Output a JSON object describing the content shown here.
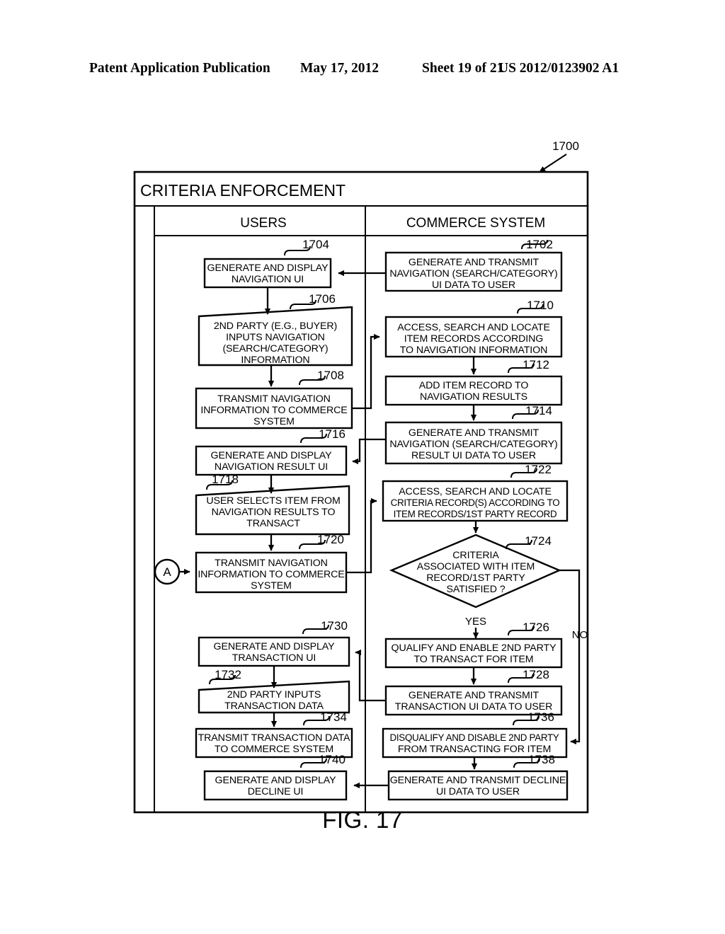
{
  "header": {
    "publication": "Patent Application Publication",
    "date": "May 17, 2012",
    "sheet": "Sheet 19 of 21",
    "docnumber": "US 2012/0123902 A1"
  },
  "figure": {
    "caption": "FIG. 17",
    "diagram_ref": "1700",
    "title": "CRITERIA ENFORCEMENT",
    "columns": [
      {
        "label": "USERS"
      },
      {
        "label": "COMMERCE SYSTEM"
      }
    ],
    "connectors": [
      {
        "label": "A"
      }
    ],
    "branch_labels": {
      "yes": "YES",
      "no": "NO"
    },
    "nodes": [
      {
        "ref": "1702",
        "column": "commerce",
        "shape": "process",
        "lines": [
          "GENERATE AND TRANSMIT",
          "NAVIGATION (SEARCH/CATEGORY)",
          "UI DATA TO USER"
        ]
      },
      {
        "ref": "1704",
        "column": "users",
        "shape": "process",
        "lines": [
          "GENERATE AND DISPLAY",
          "NAVIGATION UI"
        ]
      },
      {
        "ref": "1706",
        "column": "users",
        "shape": "manual-input",
        "lines": [
          "2ND PARTY (E.G., BUYER)",
          "INPUTS NAVIGATION",
          "(SEARCH/CATEGORY)",
          "INFORMATION"
        ]
      },
      {
        "ref": "1708",
        "column": "users",
        "shape": "process",
        "lines": [
          "TRANSMIT NAVIGATION",
          "INFORMATION TO COMMERCE",
          "SYSTEM"
        ]
      },
      {
        "ref": "1710",
        "column": "commerce",
        "shape": "process",
        "lines": [
          "ACCESS, SEARCH AND LOCATE",
          "ITEM RECORDS ACCORDING",
          "TO NAVIGATION INFORMATION"
        ]
      },
      {
        "ref": "1712",
        "column": "commerce",
        "shape": "process",
        "lines": [
          "ADD ITEM RECORD TO",
          "NAVIGATION RESULTS"
        ]
      },
      {
        "ref": "1714",
        "column": "commerce",
        "shape": "process",
        "lines": [
          "GENERATE AND TRANSMIT",
          "NAVIGATION (SEARCH/CATEGORY)",
          "RESULT UI DATA TO USER"
        ]
      },
      {
        "ref": "1716",
        "column": "users",
        "shape": "process",
        "lines": [
          "GENERATE AND DISPLAY",
          "NAVIGATION RESULT UI"
        ]
      },
      {
        "ref": "1718",
        "column": "users",
        "shape": "manual-input",
        "lines": [
          "USER SELECTS ITEM FROM",
          "NAVIGATION RESULTS TO",
          "TRANSACT"
        ]
      },
      {
        "ref": "1720",
        "column": "users",
        "shape": "process",
        "lines": [
          "TRANSMIT NAVIGATION",
          "INFORMATION TO COMMERCE",
          "SYSTEM"
        ]
      },
      {
        "ref": "1722",
        "column": "commerce",
        "shape": "process",
        "lines": [
          "ACCESS, SEARCH AND LOCATE",
          "CRITERIA RECORD(S) ACCORDING TO",
          "ITEM RECORDS/1ST PARTY RECORD"
        ]
      },
      {
        "ref": "1724",
        "column": "commerce",
        "shape": "decision",
        "lines": [
          "CRITERIA",
          "ASSOCIATED WITH ITEM",
          "RECORD/1ST PARTY",
          "SATISFIED ?"
        ]
      },
      {
        "ref": "1726",
        "column": "commerce",
        "shape": "process",
        "lines": [
          "QUALIFY AND ENABLE 2ND PARTY",
          "TO TRANSACT FOR ITEM"
        ]
      },
      {
        "ref": "1728",
        "column": "commerce",
        "shape": "process",
        "lines": [
          "GENERATE AND TRANSMIT",
          "TRANSACTION UI DATA TO USER"
        ]
      },
      {
        "ref": "1730",
        "column": "users",
        "shape": "process",
        "lines": [
          "GENERATE AND DISPLAY",
          "TRANSACTION UI"
        ]
      },
      {
        "ref": "1732",
        "column": "users",
        "shape": "manual-input",
        "lines": [
          "2ND PARTY INPUTS",
          "TRANSACTION DATA"
        ]
      },
      {
        "ref": "1734",
        "column": "users",
        "shape": "process",
        "lines": [
          "TRANSMIT TRANSACTION DATA",
          "TO COMMERCE SYSTEM"
        ]
      },
      {
        "ref": "1736",
        "column": "commerce",
        "shape": "process",
        "lines": [
          "DISQUALIFY AND DISABLE 2ND PARTY",
          "FROM TRANSACTING FOR ITEM"
        ]
      },
      {
        "ref": "1738",
        "column": "commerce",
        "shape": "process",
        "lines": [
          "GENERATE AND TRANSMIT DECLINE",
          "UI DATA TO USER"
        ]
      },
      {
        "ref": "1740",
        "column": "users",
        "shape": "process",
        "lines": [
          "GENERATE AND DISPLAY",
          "DECLINE UI"
        ]
      }
    ]
  }
}
